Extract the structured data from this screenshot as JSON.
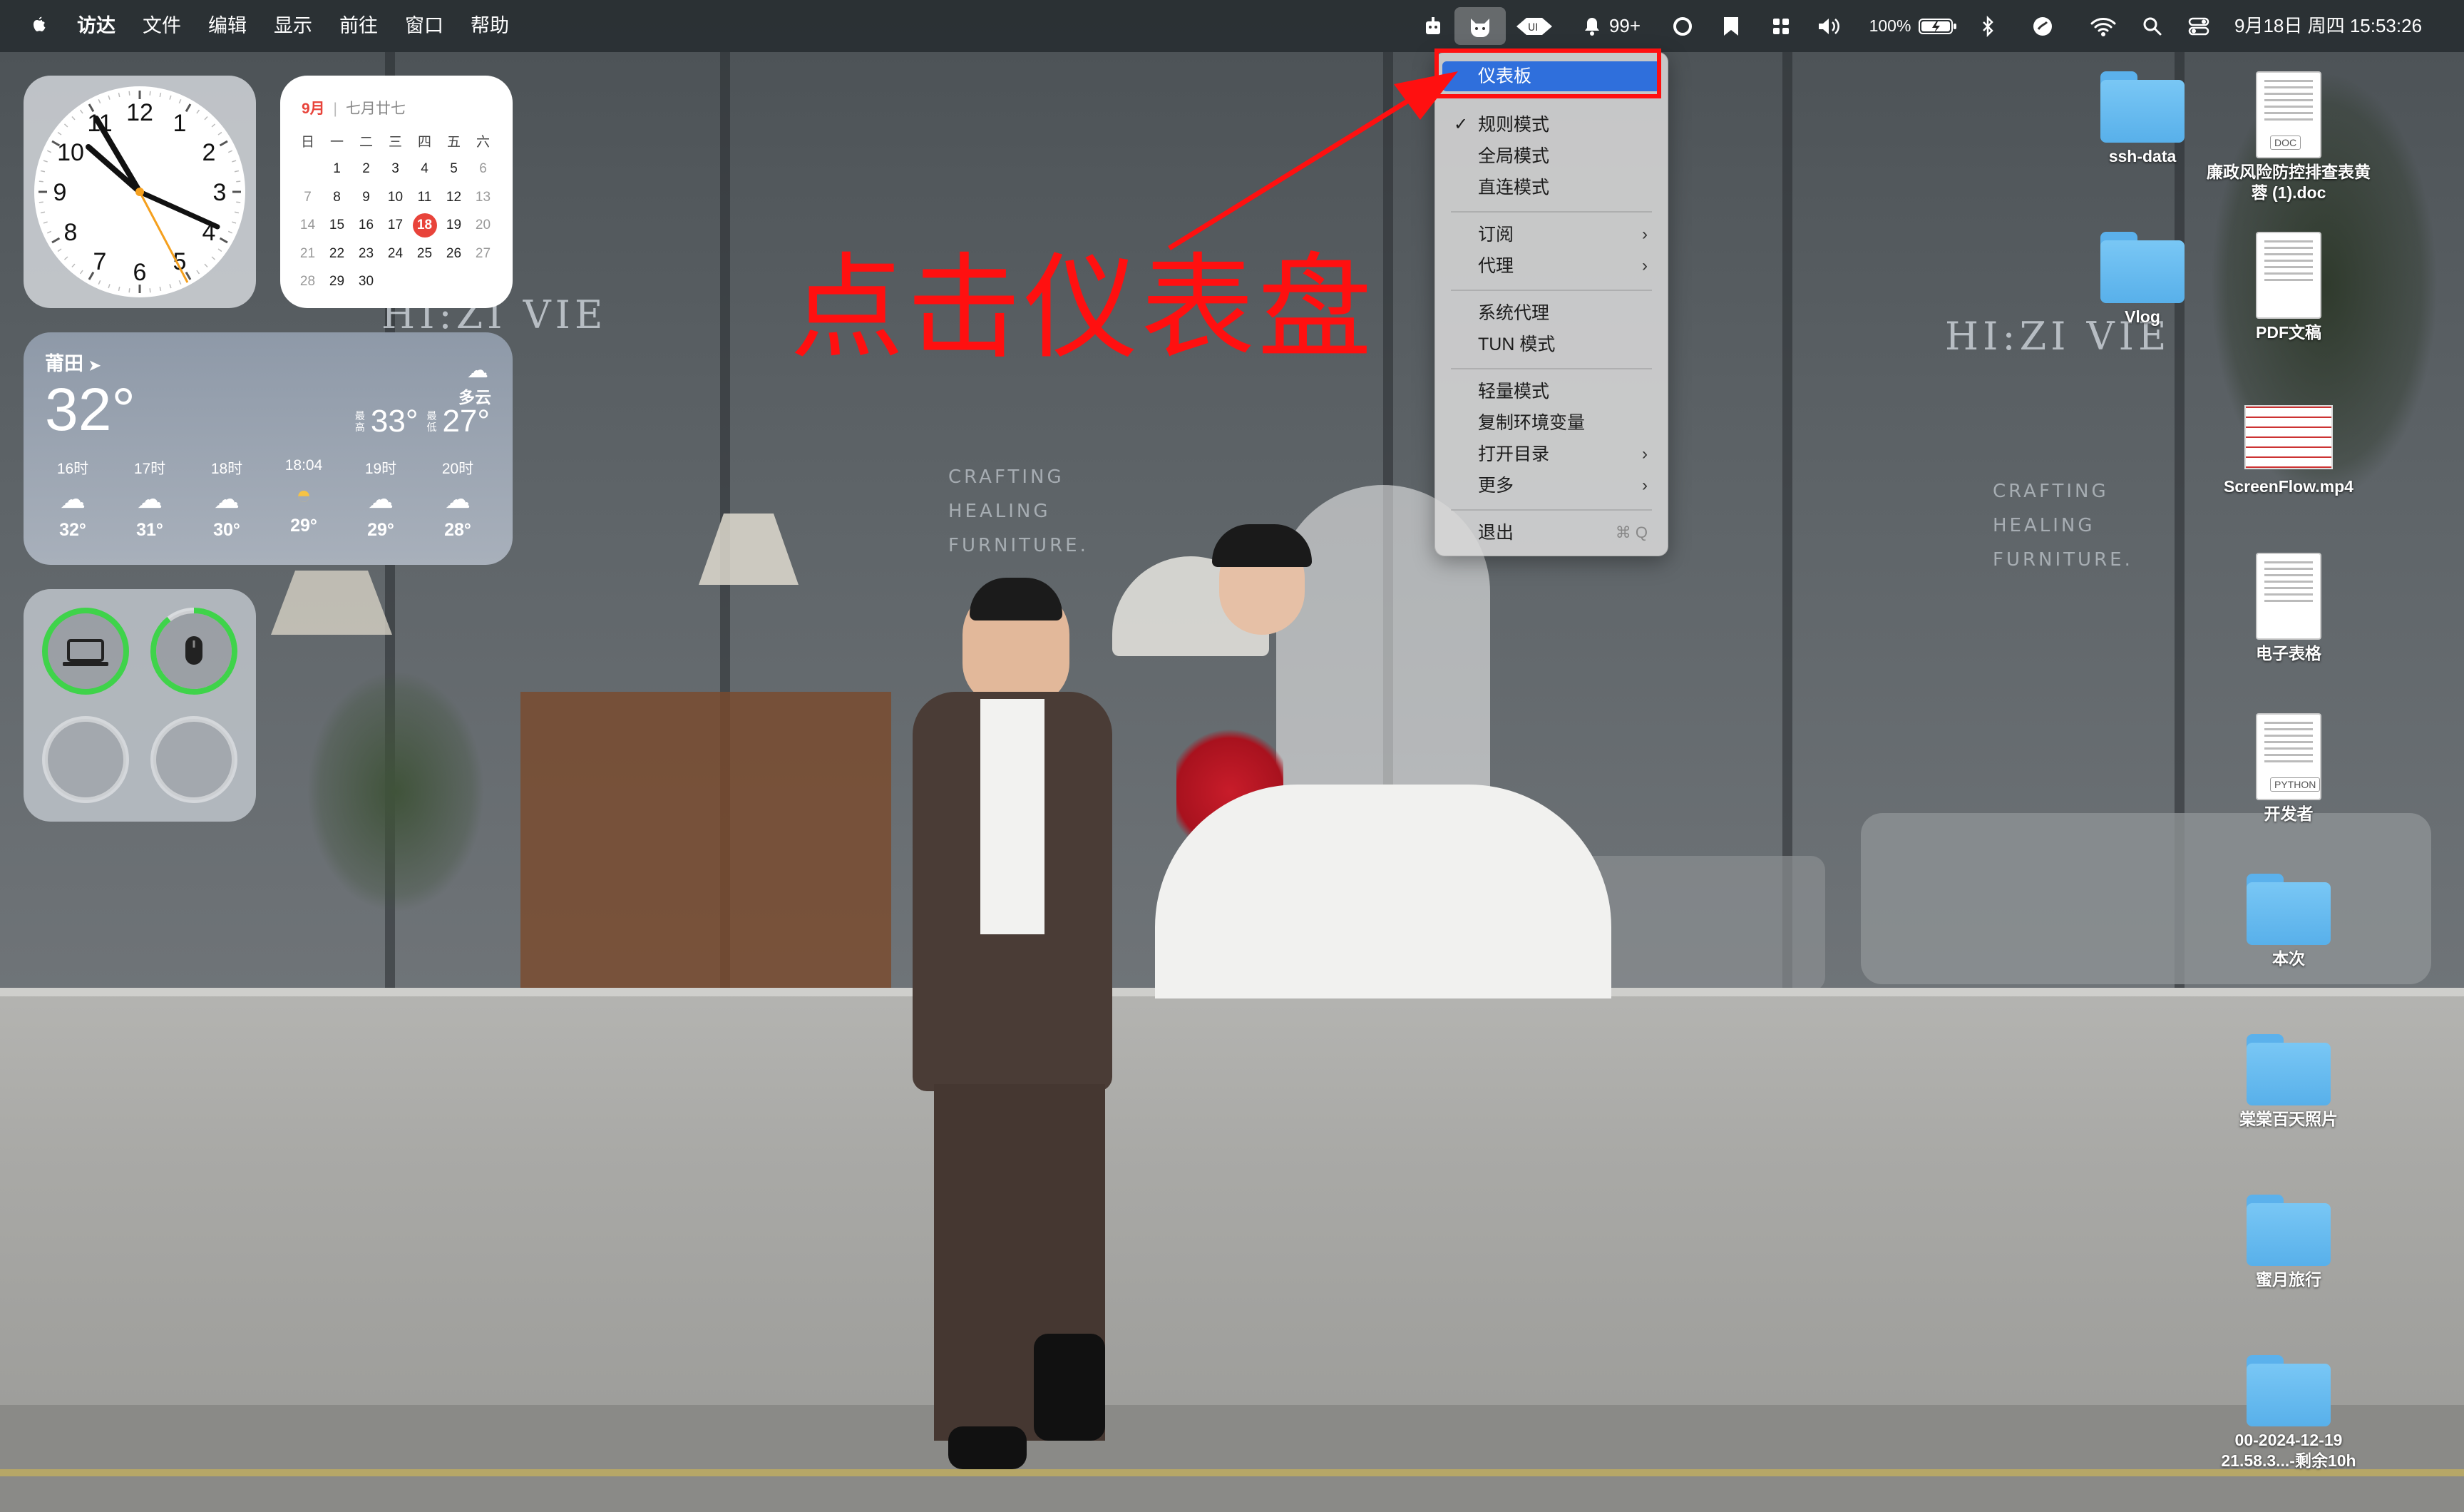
{
  "menubar": {
    "apple_icon": "apple-icon",
    "items": [
      "访达",
      "文件",
      "编辑",
      "显示",
      "前往",
      "窗口",
      "帮助"
    ],
    "notification_count": "99+",
    "battery": "100%",
    "datetime": "9月18日 周四  15:53:26"
  },
  "clock_widget": {
    "numbers": [
      "12",
      "1",
      "2",
      "3",
      "4",
      "5",
      "6",
      "7",
      "8",
      "9",
      "10",
      "11"
    ]
  },
  "calendar_widget": {
    "month": "9月",
    "lunar": "七月廿七",
    "weekdays": [
      "日",
      "一",
      "二",
      "三",
      "四",
      "五",
      "六"
    ],
    "weeks": [
      [
        "",
        "1",
        "2",
        "3",
        "4",
        "5",
        "6"
      ],
      [
        "7",
        "8",
        "9",
        "10",
        "11",
        "12",
        "13"
      ],
      [
        "14",
        "15",
        "16",
        "17",
        "18",
        "19",
        "20"
      ],
      [
        "21",
        "22",
        "23",
        "24",
        "25",
        "26",
        "27"
      ],
      [
        "28",
        "29",
        "30",
        "",
        "",
        "",
        ""
      ]
    ],
    "today": "18"
  },
  "weather_widget": {
    "city": "莆田",
    "temp": "32°",
    "condition": "多云",
    "high_label": "最高",
    "high": "33°",
    "low_label": "最低",
    "low": "27°",
    "hours": [
      {
        "time": "16时",
        "icon": "cloud-icon",
        "temp": "32°"
      },
      {
        "time": "17时",
        "icon": "cloud-icon",
        "temp": "31°"
      },
      {
        "time": "18时",
        "icon": "cloud-icon",
        "temp": "30°"
      },
      {
        "time": "18:04",
        "icon": "sunset-icon",
        "temp": "29°"
      },
      {
        "time": "19时",
        "icon": "cloud-icon",
        "temp": "29°"
      },
      {
        "time": "20时",
        "icon": "cloud-icon",
        "temp": "28°"
      }
    ]
  },
  "battery_widget": {
    "devices": [
      {
        "icon": "laptop-icon",
        "level": 1.0
      },
      {
        "icon": "mouse-icon",
        "level": 0.9
      }
    ]
  },
  "menu": {
    "items": [
      {
        "label": "仪表板",
        "highlighted": true
      },
      {
        "label": "规则模式",
        "checked": true
      },
      {
        "label": "全局模式"
      },
      {
        "label": "直连模式"
      },
      {
        "label": "订阅",
        "submenu": true
      },
      {
        "label": "代理",
        "submenu": true
      },
      {
        "label": "系统代理"
      },
      {
        "label": "TUN 模式"
      },
      {
        "label": "轻量模式"
      },
      {
        "label": "复制环境变量"
      },
      {
        "label": "打开目录",
        "submenu": true
      },
      {
        "label": "更多",
        "submenu": true
      },
      {
        "label": "退出",
        "shortcut": "⌘ Q"
      }
    ]
  },
  "annotation": {
    "text": "点击仪表盘",
    "color": "#ff1010"
  },
  "desktop_icons": [
    {
      "label": "ssh-data",
      "type": "folder"
    },
    {
      "label": "廉政风险防控排查表黄蓉 (1).doc",
      "type": "doc",
      "badge": "DOC"
    },
    {
      "label": "Vlog",
      "type": "folder"
    },
    {
      "label": "PDF文稿",
      "type": "doc",
      "badge": ""
    },
    {
      "label": "ScreenFlow.mp4",
      "type": "video"
    },
    {
      "label": "电子表格",
      "type": "doc",
      "badge": ""
    },
    {
      "label": "开发者",
      "type": "doc",
      "badge": "PYTHON"
    },
    {
      "label": "本次",
      "type": "folder"
    },
    {
      "label": "棠棠百天照片",
      "type": "folder"
    },
    {
      "label": "蜜月旅行",
      "type": "folder"
    },
    {
      "label": "00-2024-12-19 21.58.3...-剩余10h",
      "type": "folder"
    }
  ],
  "wallpaper": {
    "shop_sign": "HI:ZI VIE",
    "shop_sign_2": "HI:ZI VIE",
    "shop_tagline": [
      "CRAFTING",
      "HEALING",
      "FURNITURE."
    ]
  }
}
